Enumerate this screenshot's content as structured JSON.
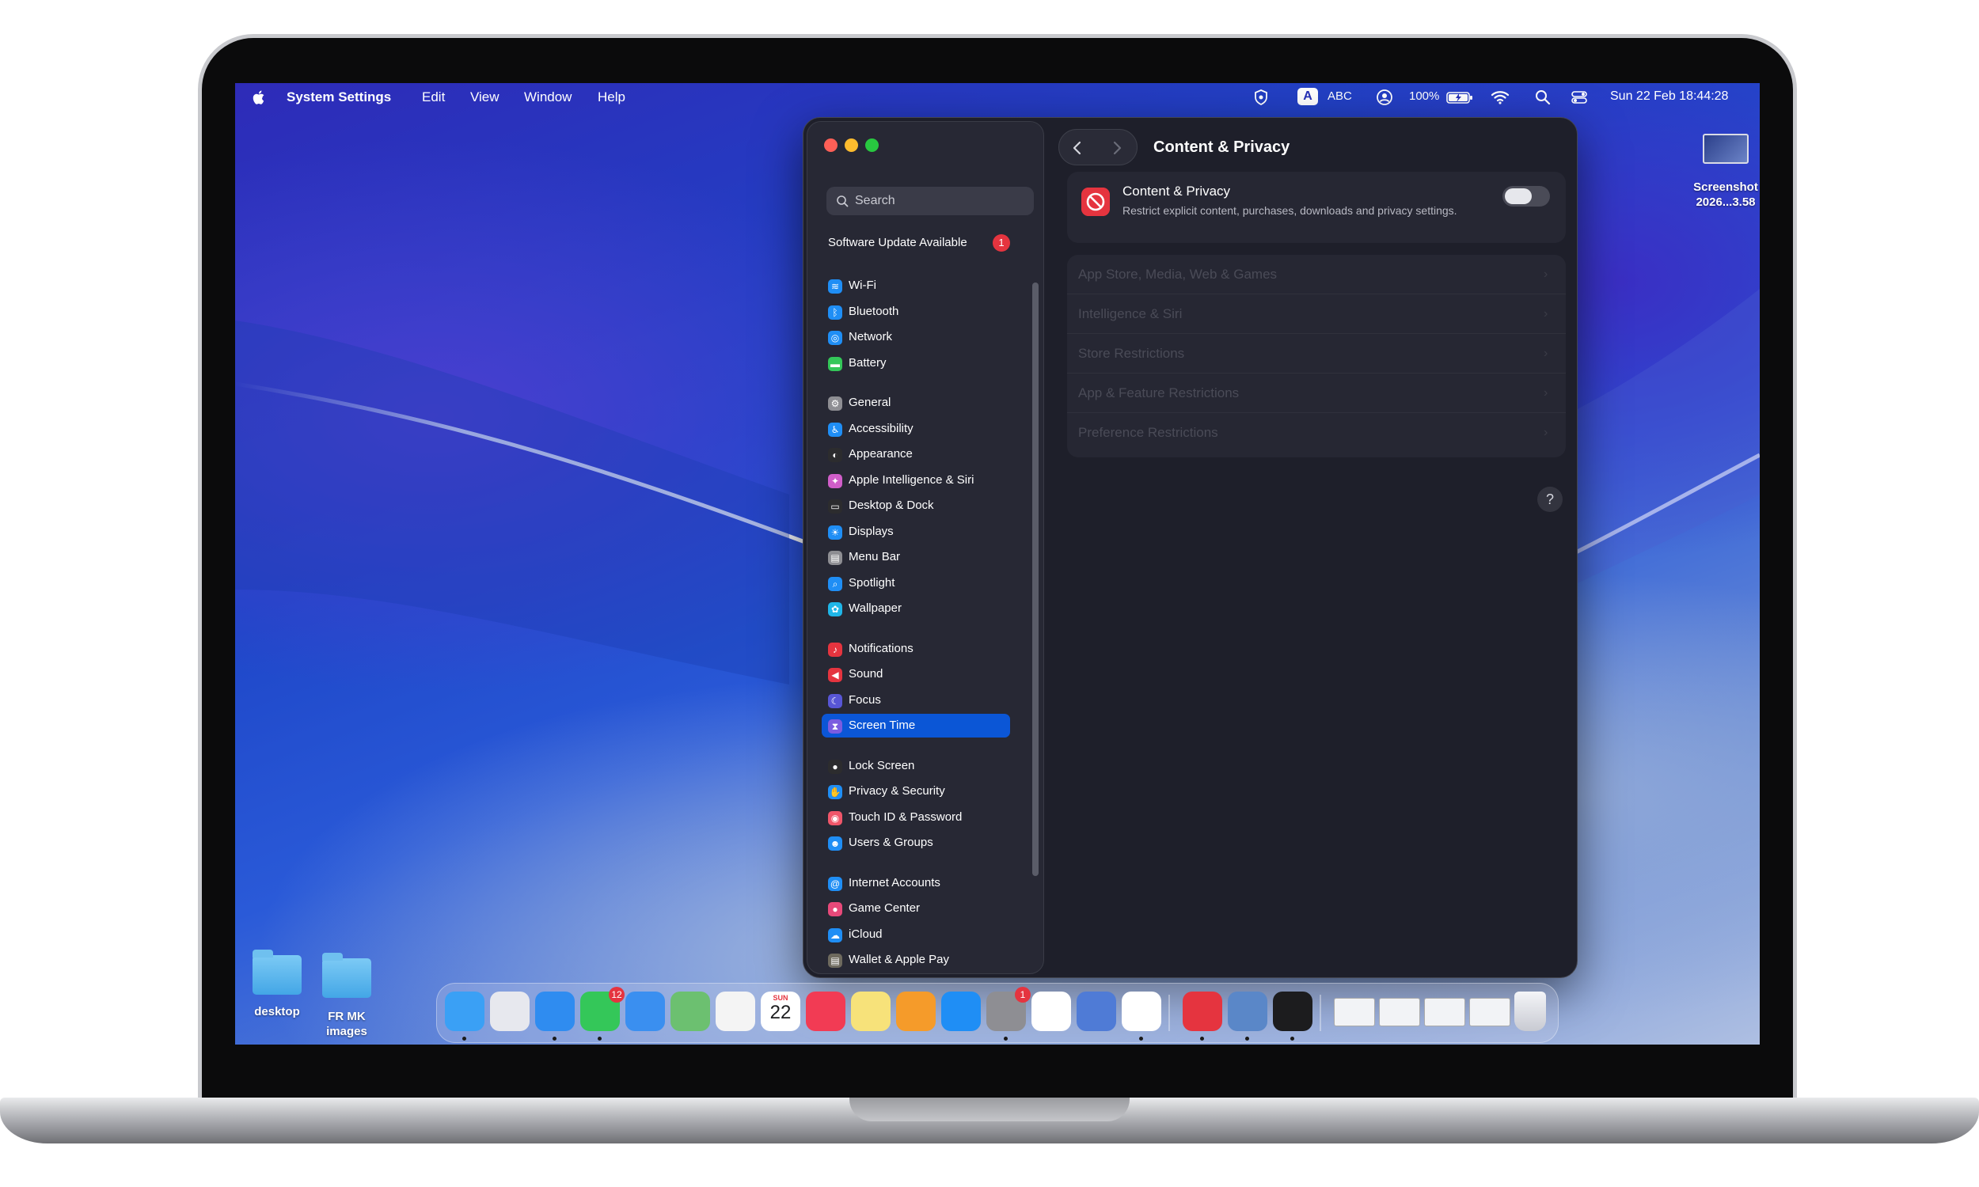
{
  "menubar": {
    "app_name": "System Settings",
    "menus": [
      "Edit",
      "View",
      "Window",
      "Help"
    ],
    "input_source": "ABC",
    "input_letter": "A",
    "battery": "100%",
    "datetime": "Sun 22 Feb  18:44:28"
  },
  "desktop": {
    "screenshot_label_line1": "Screenshot",
    "screenshot_label_line2": "2026...3.58",
    "folders": [
      "desktop",
      "FR MK\nimages"
    ]
  },
  "window": {
    "search_placeholder": "Search",
    "software_update": "Software Update Available",
    "software_update_badge": "1",
    "sidebar_groups": [
      [
        {
          "label": "Wi-Fi",
          "icon": "wifi-icon",
          "color": "#1f8ef5"
        },
        {
          "label": "Bluetooth",
          "icon": "bluetooth-icon",
          "color": "#1f8ef5"
        },
        {
          "label": "Network",
          "icon": "globe-icon",
          "color": "#1f8ef5"
        },
        {
          "label": "Battery",
          "icon": "battery-icon",
          "color": "#34c759"
        }
      ],
      [
        {
          "label": "General",
          "icon": "gear-icon",
          "color": "#8e8e93"
        },
        {
          "label": "Accessibility",
          "icon": "accessibility-icon",
          "color": "#1f8ef5"
        },
        {
          "label": "Appearance",
          "icon": "appearance-icon",
          "color": "#2c2c2e"
        },
        {
          "label": "Apple Intelligence & Siri",
          "icon": "siri-icon",
          "color": "#d05ec9"
        },
        {
          "label": "Desktop & Dock",
          "icon": "dock-icon",
          "color": "#2c2c2e"
        },
        {
          "label": "Displays",
          "icon": "sun-icon",
          "color": "#1f8ef5"
        },
        {
          "label": "Menu Bar",
          "icon": "menubar-icon",
          "color": "#8e8e93"
        },
        {
          "label": "Spotlight",
          "icon": "magnifier-icon",
          "color": "#1f8ef5"
        },
        {
          "label": "Wallpaper",
          "icon": "flower-icon",
          "color": "#1fb6e8"
        }
      ],
      [
        {
          "label": "Notifications",
          "icon": "bell-icon",
          "color": "#e5343f"
        },
        {
          "label": "Sound",
          "icon": "speaker-icon",
          "color": "#e5343f"
        },
        {
          "label": "Focus",
          "icon": "moon-icon",
          "color": "#5856d6"
        },
        {
          "label": "Screen Time",
          "icon": "hourglass-icon",
          "color": "#7b5ce0",
          "selected": true
        }
      ],
      [
        {
          "label": "Lock Screen",
          "icon": "lock-icon",
          "color": "#2c2c2e"
        },
        {
          "label": "Privacy & Security",
          "icon": "hand-icon",
          "color": "#1f8ef5"
        },
        {
          "label": "Touch ID & Password",
          "icon": "fingerprint-icon",
          "color": "#f0566a"
        },
        {
          "label": "Users & Groups",
          "icon": "users-icon",
          "color": "#1f8ef5"
        }
      ],
      [
        {
          "label": "Internet Accounts",
          "icon": "at-icon",
          "color": "#1f8ef5"
        },
        {
          "label": "Game Center",
          "icon": "gamecenter-icon",
          "color": "#e8497a"
        },
        {
          "label": "iCloud",
          "icon": "cloud-icon",
          "color": "#1f8ef5"
        },
        {
          "label": "Wallet & Apple Pay",
          "icon": "wallet-icon",
          "color": "#6e6a5e"
        }
      ]
    ],
    "main_title": "Content & Privacy",
    "cp_title": "Content & Privacy",
    "cp_desc": "Restrict explicit content, purchases, downloads and privacy settings.",
    "toggle_on": false,
    "rows": [
      "App Store, Media, Web & Games",
      "Intelligence & Siri",
      "Store Restrictions",
      "App & Feature Restrictions",
      "Preference Restrictions"
    ],
    "help": "?"
  },
  "dock": {
    "apps": [
      {
        "name": "finder-icon",
        "color": "#3aa0f5",
        "dot": true
      },
      {
        "name": "launchpad-icon",
        "color": "#e7e8ee"
      },
      {
        "name": "safari-icon",
        "color": "#2f8cf0",
        "dot": true
      },
      {
        "name": "messages-icon",
        "color": "#34c759",
        "badge": "12",
        "dot": true
      },
      {
        "name": "mail-icon",
        "color": "#3a8ff0"
      },
      {
        "name": "maps-icon",
        "color": "#6cc070"
      },
      {
        "name": "photos-icon",
        "color": "#f4f4f4"
      },
      {
        "name": "calendar-icon",
        "color": "#ffffff",
        "text": "22",
        "subtext": "SUN"
      },
      {
        "name": "music-icon",
        "color": "#f23b54"
      },
      {
        "name": "notes-icon",
        "color": "#f7e27a"
      },
      {
        "name": "pages-icon",
        "color": "#f59b2a"
      },
      {
        "name": "appstore-icon",
        "color": "#1f8ef5"
      },
      {
        "name": "system-settings-icon",
        "color": "#8e8e93",
        "badge": "1",
        "dot": true
      },
      {
        "name": "opera-icon",
        "color": "#ffffff"
      },
      {
        "name": "remote-icon",
        "color": "#4f7bd6"
      },
      {
        "name": "chrome-icon",
        "color": "#ffffff",
        "dot": true
      },
      {
        "name": "vpn-icon",
        "color": "#e5343f",
        "dot": true
      },
      {
        "name": "disk-utility-icon",
        "color": "#5a87c8",
        "dot": true
      },
      {
        "name": "activity-monitor-icon",
        "color": "#1c1c1e",
        "dot": true
      }
    ],
    "badge_messages": "12",
    "badge_settings": "1",
    "calendar_day": "22",
    "calendar_dow": "SUN"
  }
}
